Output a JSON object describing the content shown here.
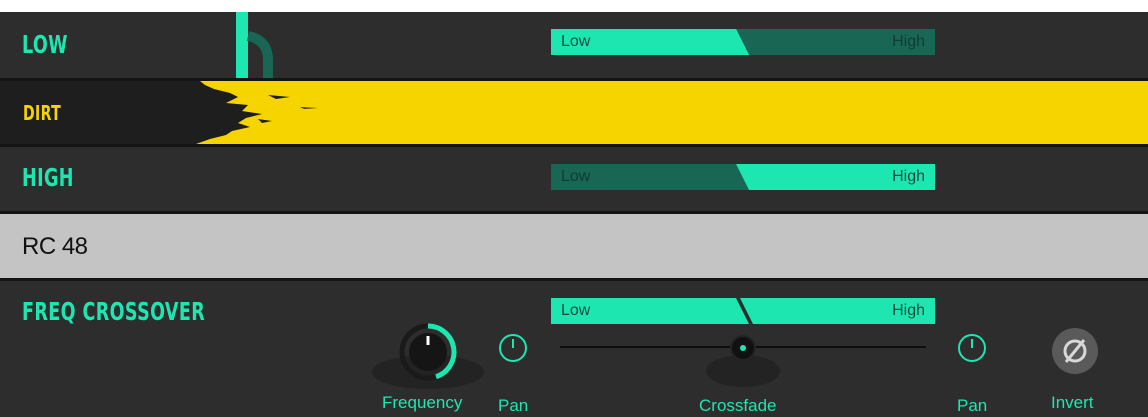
{
  "rows": {
    "low": {
      "title": "LOW"
    },
    "dirt": {
      "title": "DIRT"
    },
    "high": {
      "title": "HIGH"
    },
    "rc": {
      "title": "RC 48"
    },
    "freq": {
      "title": "FREQ CROSSOVER"
    }
  },
  "switches": {
    "low": {
      "left": "Low",
      "right": "High",
      "active": "Low"
    },
    "high": {
      "left": "Low",
      "right": "High",
      "active": "High"
    },
    "freq": {
      "left": "Low",
      "right": "High",
      "active": "both"
    }
  },
  "controls": {
    "frequency": {
      "label": "Frequency",
      "value_fraction": 0.45
    },
    "pan_left": {
      "label": "Pan"
    },
    "crossfade": {
      "label": "Crossfade",
      "value_fraction": 0.5
    },
    "pan_right": {
      "label": "Pan"
    },
    "invert": {
      "label": "Invert",
      "icon": "phase-invert-icon"
    }
  },
  "colors": {
    "accent": "#1ee6b0",
    "accent_dark": "#1a6655",
    "dirt_yellow": "#f5d400",
    "rc_bar": "#c4c4c4",
    "background": "#2b2b2b"
  }
}
